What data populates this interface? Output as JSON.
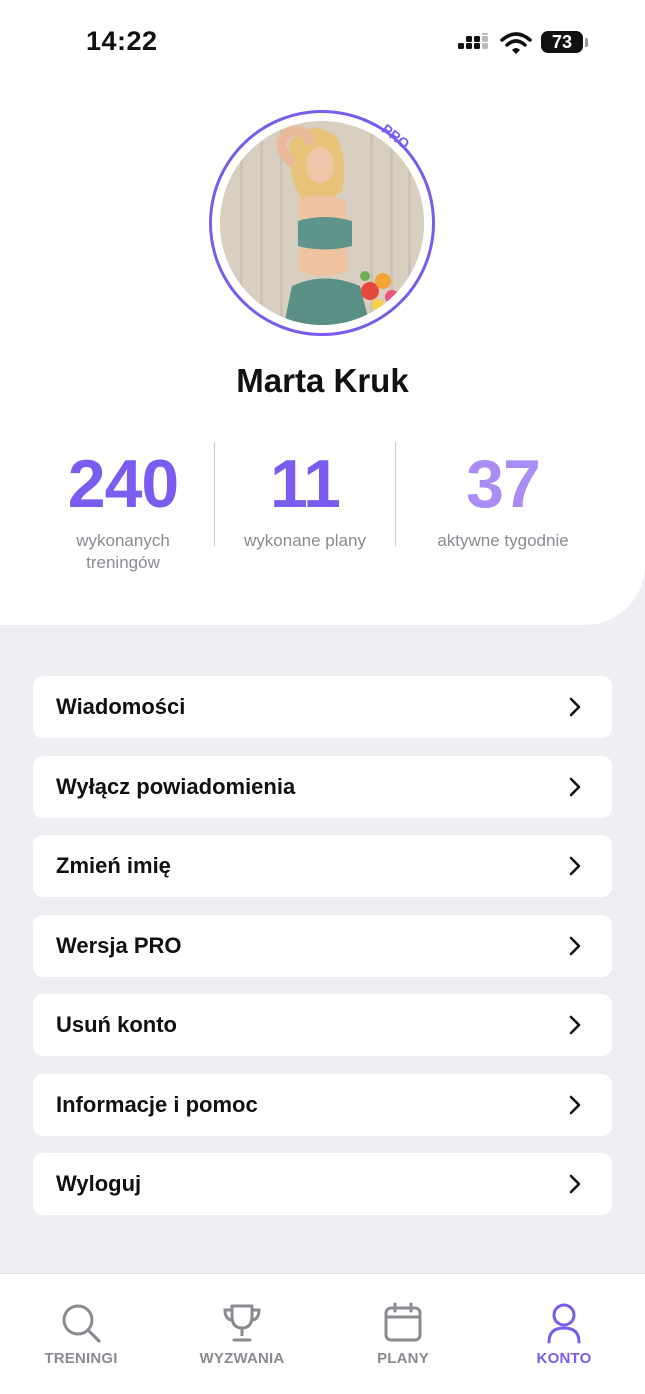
{
  "status_bar": {
    "time": "14:22",
    "battery": "73"
  },
  "profile": {
    "name": "Marta Kruk",
    "badge": "PRO"
  },
  "stats": [
    {
      "value": "240",
      "label_line1": "wykonanych",
      "label_line2": "treningów"
    },
    {
      "value": "11",
      "label": "wykonane plany"
    },
    {
      "value": "37",
      "label": "aktywne tygodnie"
    }
  ],
  "menu": [
    {
      "label": "Wiadomości"
    },
    {
      "label": "Wyłącz powiadomienia"
    },
    {
      "label": "Zmień imię"
    },
    {
      "label": "Wersja PRO"
    },
    {
      "label": "Usuń konto"
    },
    {
      "label": "Informacje i pomoc"
    },
    {
      "label": "Wyloguj"
    }
  ],
  "nav": [
    {
      "label": "TRENINGI",
      "icon": "search-icon"
    },
    {
      "label": "WYZWANIA",
      "icon": "trophy-icon"
    },
    {
      "label": "PLANY",
      "icon": "calendar-icon"
    },
    {
      "label": "KONTO",
      "icon": "user-icon",
      "active": true
    }
  ],
  "colors": {
    "accent": "#7b5cf0",
    "accent_light": "#a98df4",
    "background": "#efeef2"
  }
}
